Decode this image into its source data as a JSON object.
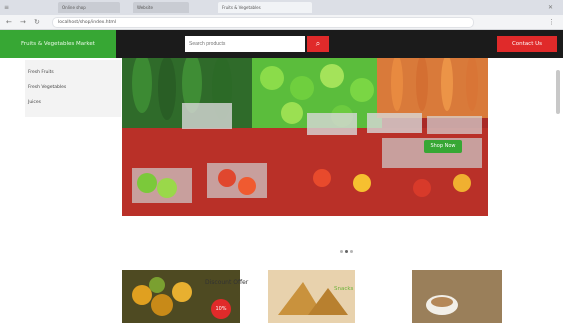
{
  "browser": {
    "tabs": [
      {
        "label": "Online shop"
      },
      {
        "label": "Website"
      },
      {
        "label": "Fruits & Vegetables"
      }
    ],
    "address": "localhost/shop/index.html"
  },
  "header": {
    "brand": "Fruits & Vegetables Market",
    "search_placeholder": "Search products",
    "search_icon": "search-icon",
    "contact_label": "Contact Us"
  },
  "sidebar": {
    "items": [
      {
        "label": "Fresh Fruits"
      },
      {
        "label": "Fresh Vegetables"
      },
      {
        "label": "Juices"
      }
    ]
  },
  "hero": {
    "button_label": "Shop Now"
  },
  "cards": {
    "offer_title": "Discount Offer",
    "badge": "10%",
    "card2_label": "Snacks"
  },
  "colors": {
    "accent_green": "#37a734",
    "accent_red": "#e02a2a",
    "header_dark": "#1b1b1b"
  }
}
